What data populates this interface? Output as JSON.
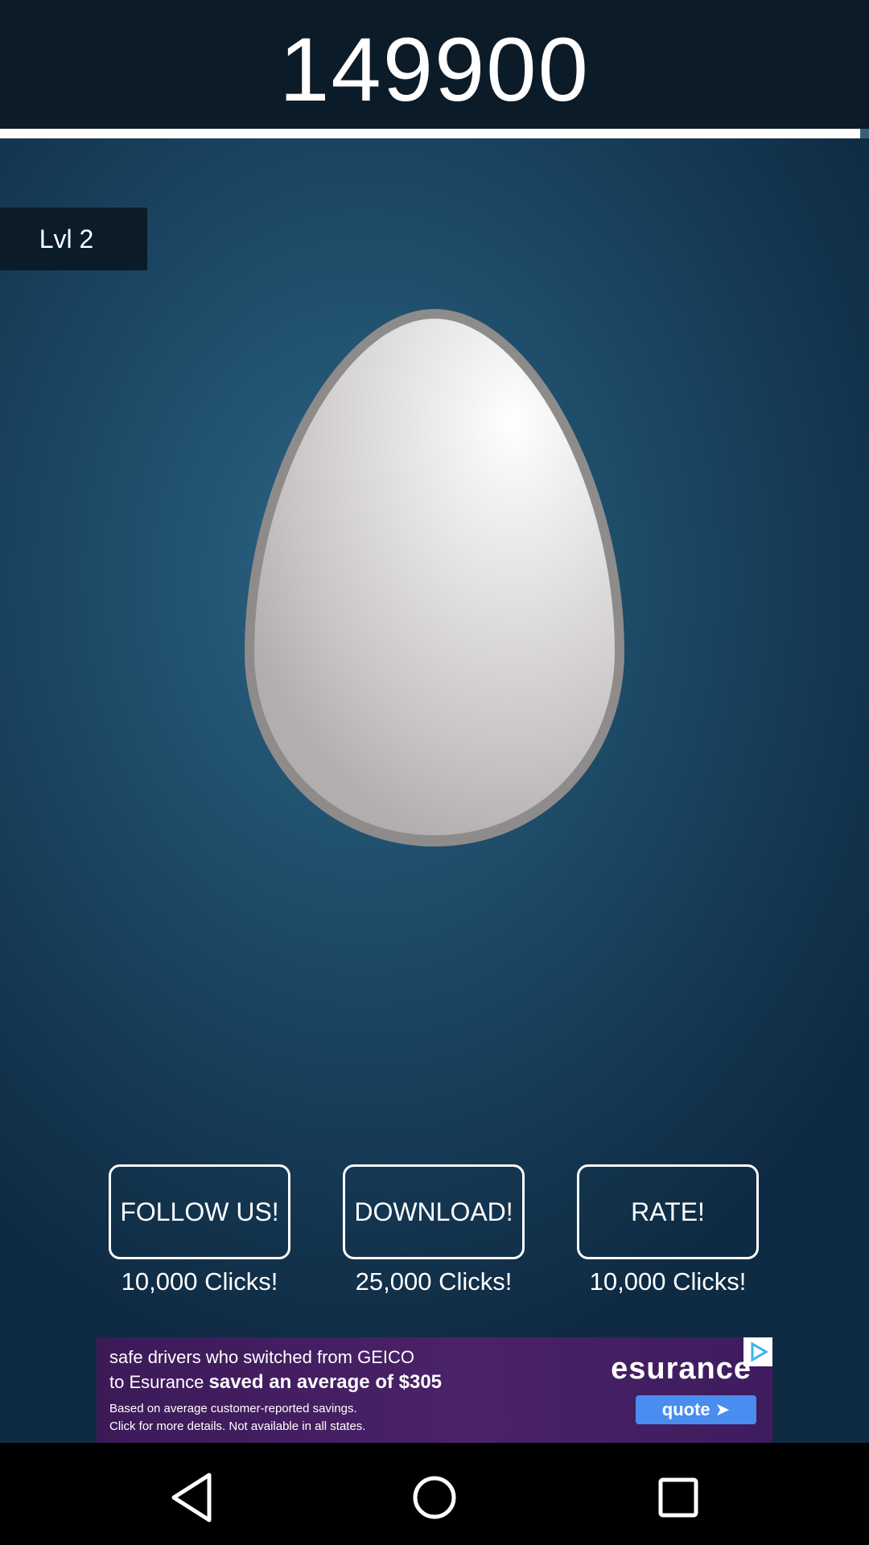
{
  "score": "149900",
  "progress": {
    "fraction": 0.99
  },
  "level": {
    "label": "Lvl 2"
  },
  "egg": {
    "icon": "egg-icon"
  },
  "actions": [
    {
      "label": "FOLLOW US!",
      "reward": "10,000 Clicks!"
    },
    {
      "label": "DOWNLOAD!",
      "reward": "25,000 Clicks!"
    },
    {
      "label": "RATE!",
      "reward": "10,000 Clicks!"
    }
  ],
  "ad": {
    "line1": "safe drivers who switched from GEICO",
    "line2_prefix": "to Esurance ",
    "line2_bold": "saved an average of $305",
    "line3": "Based on average customer-reported savings.",
    "line4": "Click for more details. Not available in all states.",
    "brand": "esurance",
    "cta": "quote",
    "choices_icon": "ad-choices-icon"
  },
  "navbar": {
    "back_icon": "back-triangle-icon",
    "home_icon": "home-circle-icon",
    "recents_icon": "recents-square-icon"
  },
  "colors": {
    "background": "#1e4d6a",
    "topbar": "#0c1b28",
    "ad_background": "#4a2268",
    "ad_button": "#4a8df0"
  }
}
